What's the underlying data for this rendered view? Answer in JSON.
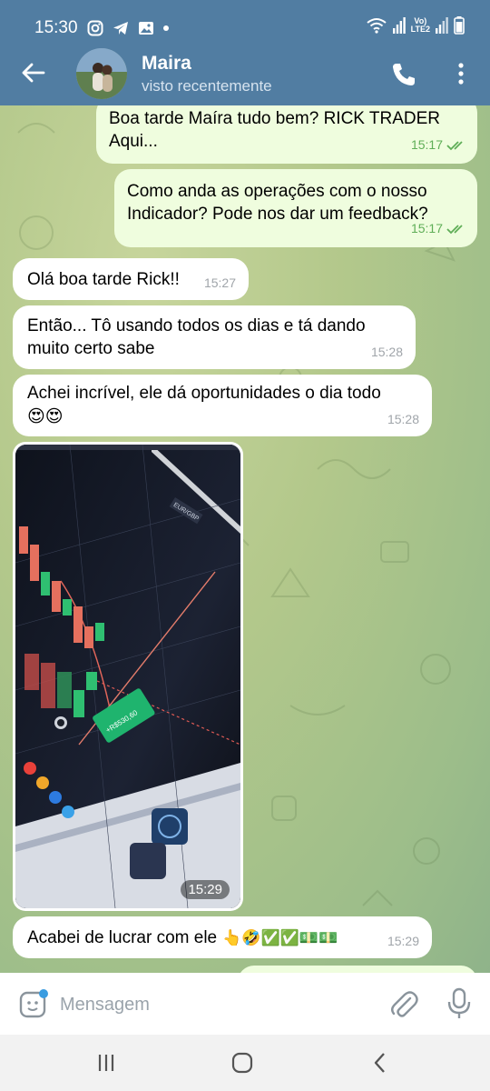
{
  "status_bar": {
    "time": "15:30",
    "network": "LTE2",
    "signal_label": "Vo)"
  },
  "header": {
    "contact_name": "Maira",
    "contact_status": "visto recentemente"
  },
  "messages": [
    {
      "text": "Boa tarde Maíra tudo bem? RICK TRADER Aqui...",
      "time": "15:17",
      "direction": "out"
    },
    {
      "text": "Como anda as operações com o nosso Indicador? Pode nos dar um feedback?",
      "time": "15:17",
      "direction": "out"
    },
    {
      "text": "Olá boa tarde Rick!!",
      "time": "15:27",
      "direction": "in"
    },
    {
      "text": "Então... Tô usando todos os dias e tá dando muito certo sabe",
      "time": "15:28",
      "direction": "in"
    },
    {
      "text": "Achei incrível, ele dá oportunidades o dia todo",
      "emoji": "😍😍",
      "time": "15:28",
      "direction": "in"
    },
    {
      "photo_time": "15:29",
      "direction": "in"
    },
    {
      "text": "Acabei de lucrar com ele",
      "emoji": "👆🤣✅✅💵💵",
      "time": "15:29",
      "direction": "in"
    }
  ],
  "photo_overlay": {
    "trade_label": "+R$530,60",
    "pair_label": "EUR/GBP"
  },
  "input": {
    "placeholder": "Mensagem"
  },
  "colors": {
    "header": "#517da2",
    "outgoing_bubble": "#effdde",
    "incoming_bubble": "#ffffff",
    "check": "#5fae57"
  }
}
